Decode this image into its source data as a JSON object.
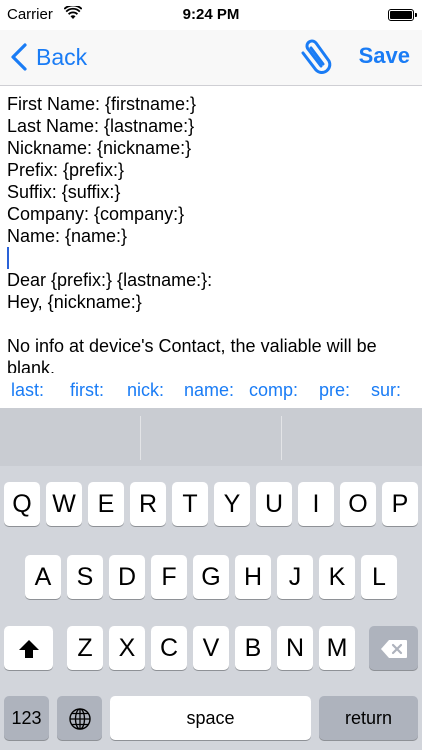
{
  "status_bar": {
    "carrier": "Carrier",
    "time": "9:24 PM"
  },
  "nav": {
    "back_label": "Back",
    "save_label": "Save"
  },
  "editor": {
    "lines": [
      "First Name: {firstname:}",
      "Last Name: {lastname:}",
      "Nickname: {nickname:}",
      "Prefix: {prefix:}",
      "Suffix: {suffix:}",
      "Company: {company:}",
      "Name: {name:}",
      "",
      "Dear {prefix:} {lastname:}:",
      "Hey, {nickname:}",
      "",
      "No info at device's Contact, the valiable will be",
      "blank."
    ]
  },
  "variable_bar": [
    "last:",
    "first:",
    "nick:",
    "name:",
    "comp:",
    "pre:",
    "sur:"
  ],
  "keyboard": {
    "row1": [
      "Q",
      "W",
      "E",
      "R",
      "T",
      "Y",
      "U",
      "I",
      "O",
      "P"
    ],
    "row2": [
      "A",
      "S",
      "D",
      "F",
      "G",
      "H",
      "J",
      "K",
      "L"
    ],
    "row3": [
      "Z",
      "X",
      "C",
      "V",
      "B",
      "N",
      "M"
    ],
    "numbers_label": "123",
    "space_label": "space",
    "return_label": "return"
  }
}
